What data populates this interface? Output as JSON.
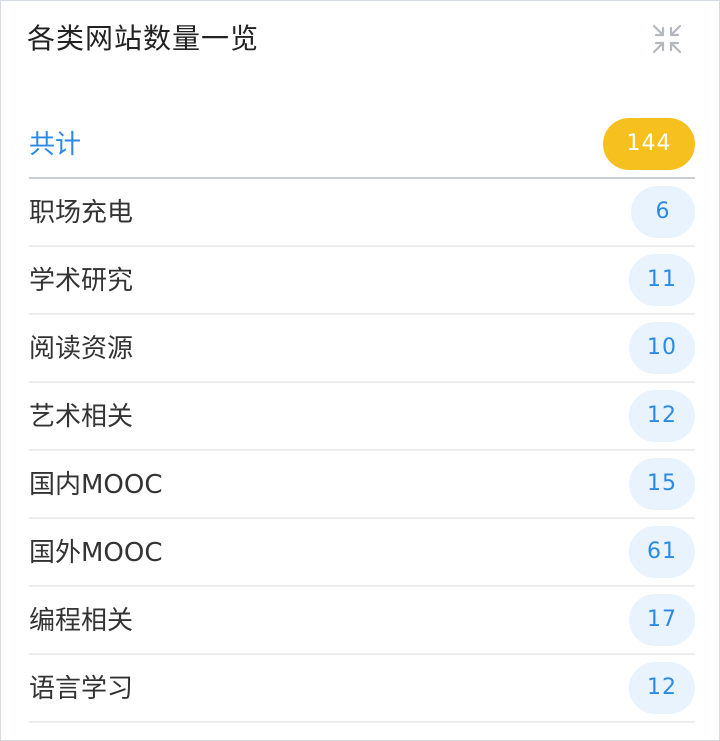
{
  "header": {
    "title": "各类网站数量一览",
    "collapse_icon": "collapse-arrows-icon"
  },
  "colors": {
    "accent_blue": "#2b8ae6",
    "total_badge": "#f6c11f",
    "count_badge_bg": "#e8f3fd"
  },
  "total": {
    "label": "共计",
    "count": "144"
  },
  "categories": [
    {
      "label": "职场充电",
      "count": "6"
    },
    {
      "label": "学术研究",
      "count": "11"
    },
    {
      "label": "阅读资源",
      "count": "10"
    },
    {
      "label": "艺术相关",
      "count": "12"
    },
    {
      "label": "国内MOOC",
      "count": "15"
    },
    {
      "label": "国外MOOC",
      "count": "61"
    },
    {
      "label": "编程相关",
      "count": "17"
    },
    {
      "label": "语言学习",
      "count": "12"
    }
  ]
}
